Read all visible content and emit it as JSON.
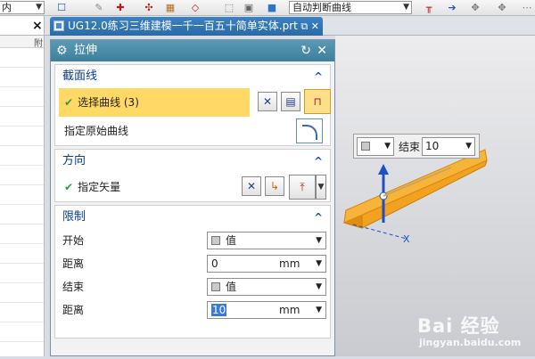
{
  "toolbar": {
    "left_select": "内",
    "curve_rule": "自动判断曲线"
  },
  "left_panel": {
    "close_glyph": "×",
    "col_header": "附"
  },
  "document_tab": {
    "title": "UG12.0练习三维建模一千一百五十简单实体.prt"
  },
  "dialog": {
    "title": "拉伸",
    "section_group": {
      "header": "截面线",
      "select_curve_label": "选择曲线 (3)",
      "origin_curve_label": "指定原始曲线"
    },
    "direction_group": {
      "header": "方向",
      "vector_label": "指定矢量"
    },
    "limits_group": {
      "header": "限制",
      "start_label": "开始",
      "start_value": "值",
      "start_distance_label": "距离",
      "start_distance": "0",
      "start_unit": "mm",
      "end_label": "结束",
      "end_value": "值",
      "end_distance_label": "距离",
      "end_distance": "10",
      "end_unit": "mm"
    }
  },
  "floating_bar": {
    "end_label": "结束",
    "end_value": "10"
  },
  "watermark": {
    "brand": "Bai 经验",
    "url": "jingyan.baidu.com"
  },
  "colors": {
    "dialog_title": "#4a8ca8",
    "selection_highlight": "#ffd866",
    "group_header": "#0a3d8f",
    "solid_face": "#f2a21e",
    "tab_active": "#2f74b6"
  }
}
